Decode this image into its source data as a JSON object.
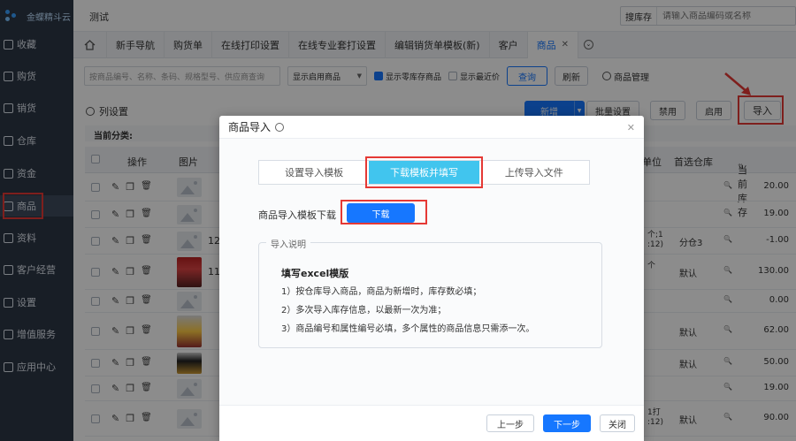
{
  "app": {
    "logo_text": "金蝶精斗云"
  },
  "topbar": {
    "page_title": "测试",
    "search_scope": "搜库存",
    "search_placeholder": "请输入商品编码或名称"
  },
  "sidebar": {
    "items": [
      {
        "label": "收藏",
        "icon": "star-icon"
      },
      {
        "label": "购货",
        "icon": "cart-icon"
      },
      {
        "label": "销货",
        "icon": "sales-icon"
      },
      {
        "label": "仓库",
        "icon": "warehouse-icon"
      },
      {
        "label": "资金",
        "icon": "money-icon"
      },
      {
        "label": "商品",
        "icon": "goods-icon",
        "active": true
      },
      {
        "label": "资料",
        "icon": "data-icon"
      },
      {
        "label": "客户经营",
        "icon": "customer-icon"
      },
      {
        "label": "设置",
        "icon": "settings-icon"
      },
      {
        "label": "增值服务",
        "icon": "value-added-icon"
      },
      {
        "label": "应用中心",
        "icon": "app-center-icon"
      }
    ]
  },
  "tabs": [
    "新手导航",
    "购货单",
    "在线打印设置",
    "在线专业套打设置",
    "编辑销货单模板(新)",
    "客户",
    "商品"
  ],
  "filters": {
    "search_placeholder": "按商品编号、名称、条码、规格型号、供应商查询",
    "status_select": "显示启用商品",
    "show_zero_stock": "显示零库存商品",
    "show_recent_price": "显示最近价",
    "query_label": "查询",
    "refresh_label": "刷新",
    "manage_label": "商品管理"
  },
  "actions": {
    "column_settings": "列设置",
    "new_label": "新增",
    "batch_label": "批量设置",
    "disable_label": "禁用",
    "enable_label": "启用",
    "import_label": "导入"
  },
  "table": {
    "category_label": "当前分类:",
    "headers": {
      "ops": "操作",
      "image": "图片",
      "unit": "单位",
      "warehouse": "首选仓库",
      "stock": "当前库存"
    },
    "rows": [
      {
        "code": "",
        "warehouse": "",
        "stock": "20.00",
        "photo": false
      },
      {
        "code": "",
        "warehouse": "",
        "stock": "19.00",
        "photo": false
      },
      {
        "code": "12",
        "warehouse": "分仓3",
        "stock": "-1.00",
        "photo": false,
        "unit": "个;1 :12)"
      },
      {
        "code": "11",
        "warehouse": "默认",
        "stock": "130.00",
        "photo": true,
        "unit": "个"
      },
      {
        "code": "",
        "warehouse": "",
        "stock": "0.00",
        "photo": false
      },
      {
        "code": "",
        "warehouse": "默认",
        "stock": "62.00",
        "photo": true
      },
      {
        "code": "",
        "warehouse": "默认",
        "stock": "50.00",
        "photo": true
      },
      {
        "code": "",
        "warehouse": "",
        "stock": "19.00",
        "photo": false
      },
      {
        "code": "",
        "warehouse": "默认",
        "stock": "90.00",
        "photo": false,
        "unit": "1打 :12)"
      }
    ]
  },
  "modal": {
    "title": "商品导入",
    "steps": [
      "设置导入模板",
      "下载模板并填写",
      "上传导入文件"
    ],
    "download_label": "商品导入模板下载",
    "download_button": "下载",
    "instructions_title": "导入说明",
    "instructions_heading": "填写excel模版",
    "instructions": [
      "1）按仓库导入商品，商品为新增时，库存数必填；",
      "2）多次导入库存信息，以最新一次为准；",
      "3）商品编号和属性编号必填，多个属性的商品信息只需添一次。"
    ],
    "prev_label": "上一步",
    "next_label": "下一步",
    "close_label": "关闭"
  },
  "colors": {
    "accent": "#1677ff",
    "step_active": "#41c5ee",
    "sidebar_bg": "#2d3746",
    "highlight": "#e53935"
  }
}
